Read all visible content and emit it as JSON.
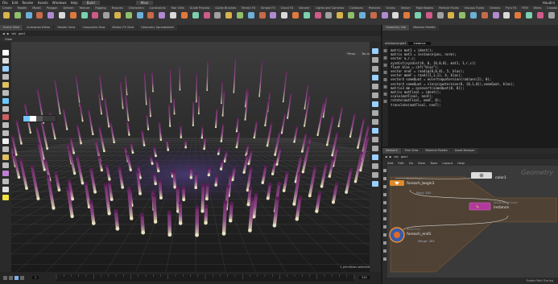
{
  "menubar": {
    "items": [
      "File",
      "Edit",
      "Render",
      "Assets",
      "Windows",
      "Help",
      "Build",
      "Main"
    ],
    "right_text": "Houdini"
  },
  "shelf_tabs": [
    "Create",
    "Modify",
    "Model",
    "Polygon",
    "Deform",
    "Texture",
    "Rigging",
    "Muscles",
    "Characters",
    "Constraints",
    "Hair Utils",
    "Guide Process",
    "Guide Brushes",
    "Terrain FX",
    "Simple FX",
    "Cloud FX",
    "Volume"
  ],
  "shelf_right_tabs": [
    "Lights and Cameras",
    "Collisions",
    "Particles",
    "Grains",
    "Vellum",
    "Rigid Bodies",
    "Particle Fluids",
    "Viscous Fluids",
    "Oceans",
    "Pyro FX",
    "FEM",
    "Wires",
    "Crowds",
    "Drive Simulation"
  ],
  "panel_tabs_left": [
    "Scene View",
    "Animation Editor",
    "Render View",
    "Composite View",
    "Motion FX View",
    "Geometry Spreadsheet"
  ],
  "panel_tabs_right": [
    "Geometry Info",
    "Material Palette"
  ],
  "viewport": {
    "path": "obj",
    "node": "geo1",
    "title": "View",
    "persp_label": "Persp",
    "cam_label": "No cam",
    "corner_text": "1 primitives selected"
  },
  "code_panel": {
    "node_path": "attribwrangle3",
    "node_name": "instance",
    "lines": [
      "matrix mat1 = ident();",
      "",
      "matrix mat1 = instance(pos, norm);",
      "",
      "vector a,r,c;",
      "xyzdist(xyzdist(0, 0, {0,0,0}, mat1, 1,r,c))",
      "float blas = chf(\"blas\");",
      "vector nnnF = rand(@{0,0,0}, 5, blas);",
      "vector mmnF = rand({1,1,1}, 4, blas);",
      "",
      "vector4 someQuat = eulertoquaternion(radians(2), 0);",
      "vector4 someQuat = slerp(quaternion(0, {0,1,0}),someQuat, blas);",
      "",
      "matrix3 mm = qconvert(someQuat(0, 0));",
      "",
      "matrix matFinal = ident();",
      "",
      "scale(matFinal, nnnF);",
      "rotate(matFinal, nmnF, 0);",
      "translate(matFinal, nnnF);"
    ]
  },
  "network": {
    "tabs": [
      "Network",
      "Tree View",
      "Material Palette",
      "Asset Browser"
    ],
    "path": "obj",
    "node": "geo1",
    "menu": [
      "Add",
      "Edit",
      "Go",
      "View",
      "Tools",
      "Layout",
      "Help"
    ],
    "watermark": "Geometry",
    "nodes": {
      "color": {
        "name": "color1"
      },
      "foreach_begin": {
        "type": "Block Begin",
        "name": "foreach_begin1",
        "sub": "Point: 283"
      },
      "instance": {
        "type": "Attribute Wrangle",
        "name": "instance"
      },
      "foreach_end": {
        "type": "Block End",
        "name": "foreach_end1",
        "sub": "Merge: 283"
      }
    },
    "status": "Enable Path Tracing"
  },
  "timeline": {
    "frame": "1",
    "end": "240"
  }
}
